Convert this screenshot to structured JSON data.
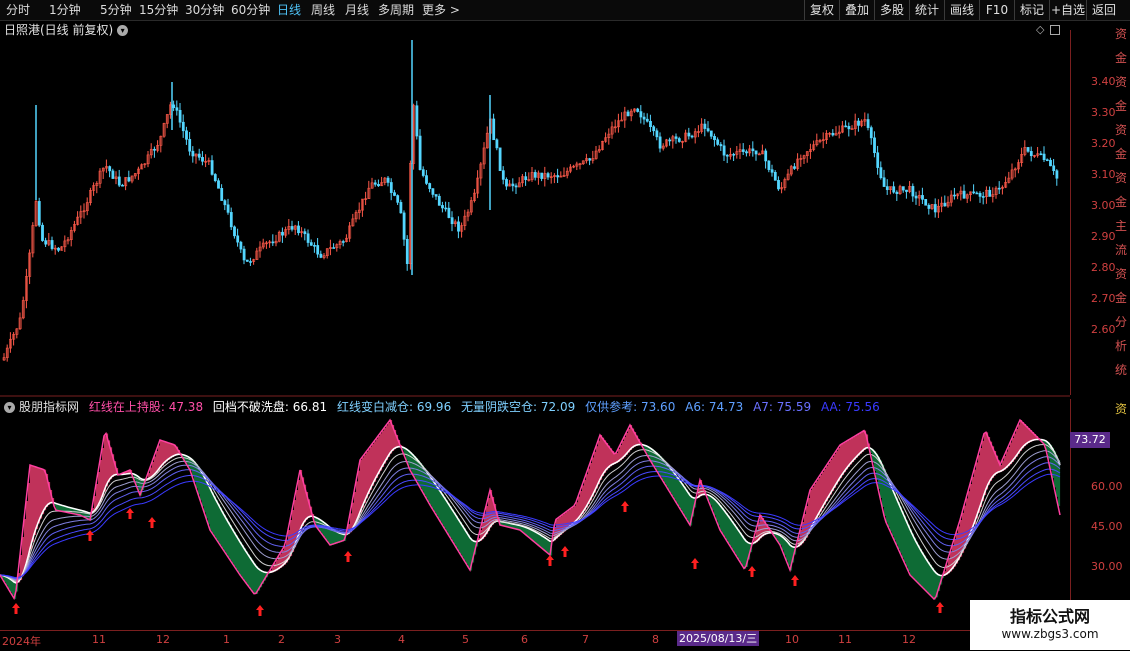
{
  "toolbar": {
    "periods": [
      "分时",
      "1分钟",
      "5分钟",
      "15分钟",
      "30分钟",
      "60分钟",
      "日线",
      "周线",
      "月线",
      "多周期",
      "更多 >"
    ],
    "active_period": "日线",
    "right_buttons": [
      "复权",
      "叠加",
      "多股",
      "统计",
      "画线",
      "F10",
      "标记",
      "+自选",
      "返回"
    ]
  },
  "chart": {
    "title": "日照港(日线 前复权)",
    "dropdown_icon": "chevron-down-icon"
  },
  "price_axis": {
    "ticks": [
      "3.40",
      "3.30",
      "3.20",
      "3.10",
      "3.00",
      "2.90",
      "2.80",
      "2.70",
      "2.60"
    ]
  },
  "indicator": {
    "name": "股朋指标网",
    "items": [
      {
        "label": "红线在上持股:",
        "value": "47.38",
        "color": "#ff4fa8"
      },
      {
        "label": "回档不破洗盘:",
        "value": "66.81",
        "color": "#ffffff"
      },
      {
        "label": "红线变白减仓:",
        "value": "69.96",
        "color": "#7fd0ff"
      },
      {
        "label": "无量阴跌空仓:",
        "value": "72.09",
        "color": "#7fd0ff"
      },
      {
        "label": "仅供参考:",
        "value": "73.60",
        "color": "#5fa0ff"
      },
      {
        "label": "A6:",
        "value": "74.73",
        "color": "#5fa0ff"
      },
      {
        "label": "A7:",
        "value": "75.59",
        "color": "#6a70ff"
      },
      {
        "label": "AA:",
        "value": "75.56",
        "color": "#3a3aff"
      }
    ],
    "axis_ticks": [
      "60.00",
      "45.00",
      "30.00"
    ],
    "current_value": "73.72"
  },
  "time_axis": {
    "labels": [
      "2024年",
      "11",
      "12",
      "1",
      "2",
      "3",
      "4",
      "5",
      "6",
      "7",
      "8",
      "10",
      "11",
      "12"
    ],
    "crosshair_date": "2025/08/13/三"
  },
  "watermark": {
    "title": "指标公式网",
    "url": "www.zbgs3.com"
  },
  "colors": {
    "up": "#ff5a4a",
    "down": "#54d6ff",
    "bg": "#000000",
    "axis": "#d04040",
    "fill_red": "#c0325a",
    "fill_green": "#0e6b35"
  },
  "side_chars": [
    "资",
    "金",
    "资",
    "金",
    "资",
    "金",
    "资",
    "金",
    "主",
    "流",
    "资",
    "金",
    "分",
    "析",
    "统"
  ]
}
